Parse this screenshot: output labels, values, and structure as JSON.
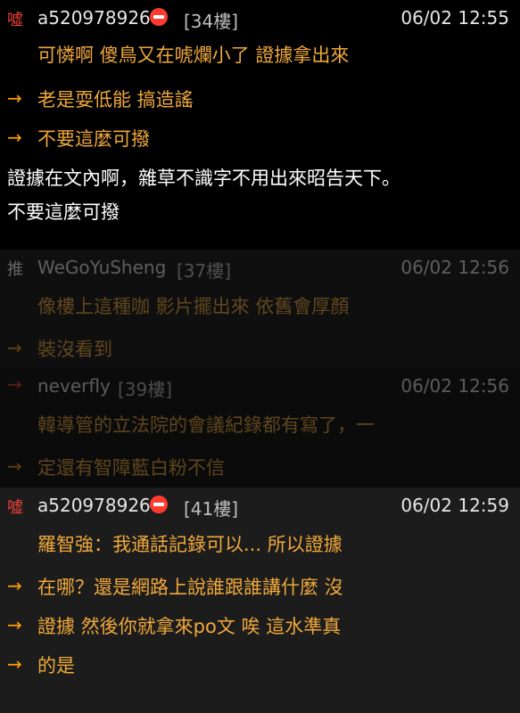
{
  "posts": [
    {
      "tag": "噓",
      "user": "a520978926",
      "floor": "[34樓]",
      "time": "06/02 12:55",
      "main": "可憐啊 傻鳥又在唬爛小了 證據拿出來",
      "replies": [
        "老是耍低能 搞造謠",
        "不要這麼可撥"
      ]
    },
    {
      "tag": "推",
      "user": "WeGoYuSheng",
      "floor": "[37樓]",
      "time": "06/02 12:56",
      "main": "像樓上這種咖 影片擺出來 依舊會厚顏",
      "replies": [
        "裝沒看到"
      ]
    },
    {
      "tag": "→",
      "user": "neverfly",
      "floor": "[39樓]",
      "time": "06/02 12:56",
      "main": "韓導管的立法院的會議紀錄都有寫了，一",
      "replies": [
        "定還有智障藍白粉不信"
      ]
    },
    {
      "tag": "噓",
      "user": "a520978926",
      "floor": "[41樓]",
      "time": "06/02 12:59",
      "main": "羅智強：我通話記錄可以... 所以證據",
      "replies": [
        "在哪？還是網路上說誰跟誰講什麼 沒",
        "證據 然後你就拿來po文 唉 這水準真",
        "的是"
      ]
    }
  ],
  "op_reply": {
    "line1": "證據在文內啊，雜草不識字不用出來昭告天下。",
    "line2": "不要這麼可撥"
  },
  "arrow_glyph": "→"
}
